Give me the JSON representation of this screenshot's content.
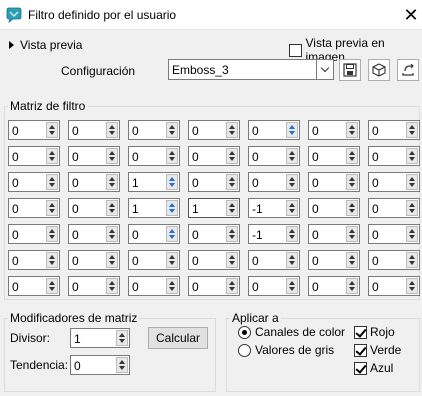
{
  "window": {
    "title": "Filtro definido por el usuario",
    "close_glyph": "✕"
  },
  "preview": {
    "label": "Vista previa",
    "image_preview_label": "Vista previa en imagen",
    "image_preview_checked": false
  },
  "config": {
    "label": "Configuración",
    "value": "Emboss_3"
  },
  "matrix": {
    "title": "Matriz de filtro",
    "rows": [
      [
        "0",
        "0",
        "0",
        "0",
        "0",
        "0",
        "0"
      ],
      [
        "0",
        "0",
        "0",
        "0",
        "0",
        "0",
        "0"
      ],
      [
        "0",
        "0",
        "1",
        "0",
        "0",
        "0",
        "0"
      ],
      [
        "0",
        "0",
        "1",
        "1",
        "-1",
        "0",
        "0"
      ],
      [
        "0",
        "0",
        "0",
        "0",
        "-1",
        "0",
        "0"
      ],
      [
        "0",
        "0",
        "0",
        "0",
        "0",
        "0",
        "0"
      ],
      [
        "0",
        "0",
        "0",
        "0",
        "0",
        "0",
        "0"
      ]
    ]
  },
  "modifiers": {
    "title": "Modificadores de matriz",
    "divisor_label": "Divisor:",
    "divisor_value": "1",
    "bias_label": "Tendencia:",
    "bias_value": "0",
    "calc_label": "Calcular"
  },
  "apply": {
    "title": "Aplicar a",
    "radio_color": "Canales de color",
    "radio_gray": "Valores de gris",
    "selected": "color",
    "red": "Rojo",
    "green": "Verde",
    "blue": "Azul",
    "red_checked": true,
    "green_checked": true,
    "blue_checked": true
  },
  "colors": {
    "accent": "#1e6fd9",
    "icon_teal": "#2a9fb5"
  }
}
